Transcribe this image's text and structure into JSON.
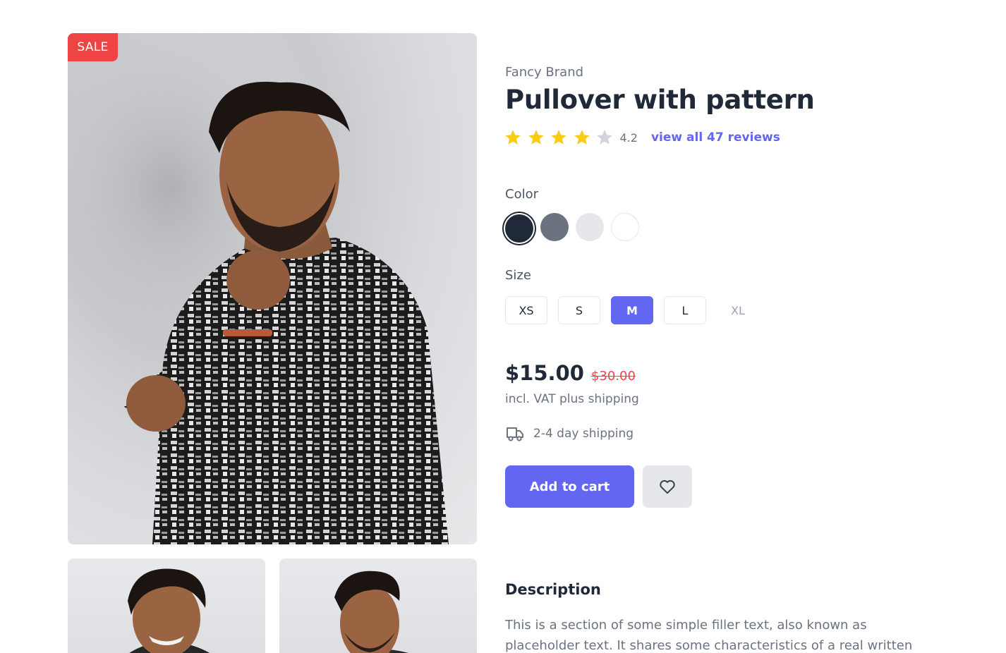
{
  "product": {
    "badge": "SALE",
    "brand": "Fancy Brand",
    "title": "Pullover with pattern",
    "rating": {
      "value": "4.2",
      "stars_filled": 4,
      "stars_total": 5,
      "reviews_link": "view all 47 reviews"
    },
    "color": {
      "label": "Color",
      "options": [
        {
          "name": "dark",
          "hex": "#1f2937",
          "selected": true
        },
        {
          "name": "gray",
          "hex": "#6b7280",
          "selected": false
        },
        {
          "name": "light-gray",
          "hex": "#e5e7eb",
          "selected": false
        },
        {
          "name": "white",
          "hex": "#ffffff",
          "selected": false
        }
      ]
    },
    "size": {
      "label": "Size",
      "options": [
        {
          "label": "XS",
          "state": "default"
        },
        {
          "label": "S",
          "state": "default"
        },
        {
          "label": "M",
          "state": "selected"
        },
        {
          "label": "L",
          "state": "default"
        },
        {
          "label": "XL",
          "state": "disabled"
        }
      ]
    },
    "price": "$15.00",
    "old_price": "$30.00",
    "vat_note": "incl. VAT plus shipping",
    "shipping": {
      "icon": "truck-icon",
      "text": "2-4 day shipping"
    },
    "actions": {
      "add_to_cart": "Add to cart",
      "wishlist_icon": "heart-icon"
    },
    "description": {
      "heading": "Description",
      "text": "This is a section of some simple filler text, also known as placeholder text. It shares some characteristics of a real written"
    }
  },
  "colors": {
    "accent": "#6366f1",
    "sale": "#ef4444",
    "star": "#facc15",
    "star_empty": "#d1d5db"
  }
}
